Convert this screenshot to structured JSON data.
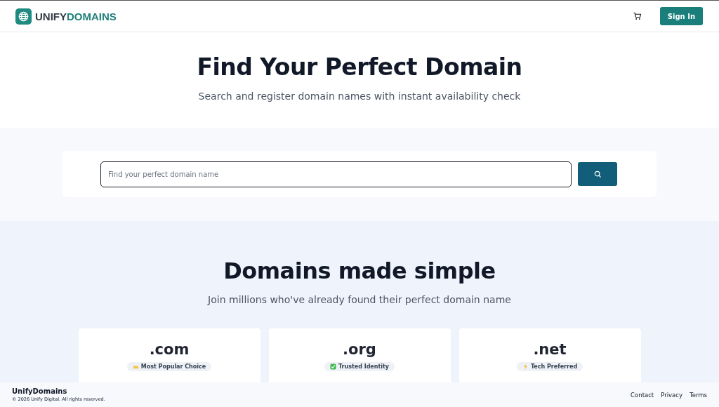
{
  "header": {
    "logo": {
      "part_1": "UNIFY",
      "part_2": "DOMAINS"
    },
    "sign_in": "Sign In"
  },
  "hero": {
    "title": "Find Your Perfect Domain",
    "subtitle": "Search and register domain names with instant availability check"
  },
  "search": {
    "placeholder": "Find your perfect domain name"
  },
  "features": {
    "title": "Domains made simple",
    "subtitle": "Join millions who've already found their perfect domain name",
    "cards": [
      {
        "tld": ".com",
        "badge": "Most Popular Choice",
        "kind": "crown"
      },
      {
        "tld": ".org",
        "badge": "Trusted Identity",
        "kind": "check"
      },
      {
        "tld": ".net",
        "badge": "Tech Preferred",
        "kind": "bolt"
      }
    ]
  },
  "footer": {
    "brand": "UnifyDomains",
    "copyright": "© 2026 Unify Digital. All rights reserved.",
    "links": [
      "Contact",
      "Privacy",
      "Terms"
    ]
  }
}
